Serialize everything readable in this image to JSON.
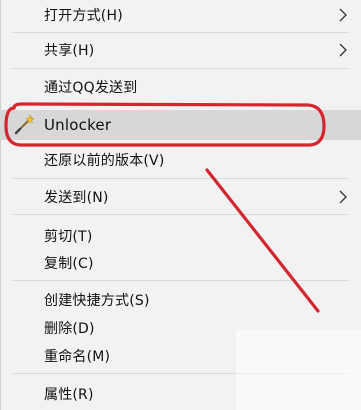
{
  "menu": {
    "items": [
      {
        "label": "打开方式(H)",
        "has_submenu": true
      },
      {
        "label": "共享(H)",
        "has_submenu": true
      },
      {
        "label": "通过QQ发送到",
        "has_submenu": false
      },
      {
        "label": "Unlocker",
        "has_submenu": false,
        "icon": "magic-wand-icon",
        "highlighted": true
      },
      {
        "label": "还原以前的版本(V)",
        "has_submenu": false
      },
      {
        "label": "发送到(N)",
        "has_submenu": true
      },
      {
        "label": "剪切(T)",
        "has_submenu": false
      },
      {
        "label": "复制(C)",
        "has_submenu": false
      },
      {
        "label": "创建快捷方式(S)",
        "has_submenu": false
      },
      {
        "label": "删除(D)",
        "has_submenu": false
      },
      {
        "label": "重命名(M)",
        "has_submenu": false
      },
      {
        "label": "属性(R)",
        "has_submenu": false
      }
    ]
  },
  "annotation": {
    "color": "#d3262f",
    "shapes": [
      "ellipse-around-unlocker",
      "arrow-line-pointing-to-unlocker"
    ]
  },
  "colors": {
    "menu_background": "#f2f2f2",
    "highlight_background": "#d7d7d7",
    "separator": "#d9d9d9"
  }
}
